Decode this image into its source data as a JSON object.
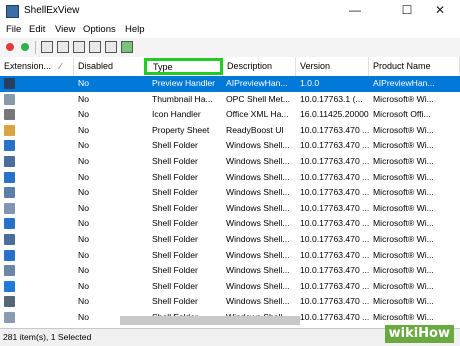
{
  "window": {
    "title": "ShellExView",
    "minimize": "—",
    "maximize": "☐",
    "close": "✕"
  },
  "menu": [
    "File",
    "Edit",
    "View",
    "Options",
    "Help"
  ],
  "colors": {
    "selection": "#0078d7",
    "highlight_box": "#22cc22"
  },
  "columns": [
    {
      "key": "ext",
      "label": "Extension...",
      "sort": "∕"
    },
    {
      "key": "disabled",
      "label": "Disabled"
    },
    {
      "key": "type",
      "label": "Type"
    },
    {
      "key": "desc",
      "label": "Description"
    },
    {
      "key": "ver",
      "label": "Version"
    },
    {
      "key": "prod",
      "label": "Product Name"
    }
  ],
  "rows": [
    {
      "icon_color": "#2a3f5f",
      "disabled": "No",
      "type": "Preview Handler",
      "desc": "AIPreviewHan...",
      "ver": "1.0.0",
      "prod": "AIPreviewHan...",
      "selected": true
    },
    {
      "icon_color": "#8899aa",
      "disabled": "No",
      "type": "Thumbnail Ha...",
      "desc": "OPC Shell Met...",
      "ver": "10.0.17763.1 (...",
      "prod": "Microsoft® Wi...",
      "selected": false
    },
    {
      "icon_color": "#777777",
      "disabled": "No",
      "type": "Icon Handler",
      "desc": "Office XML Ha...",
      "ver": "16.0.11425.20000",
      "prod": "Microsoft Offi...",
      "selected": false
    },
    {
      "icon_color": "#d9a441",
      "disabled": "No",
      "type": "Property Sheet",
      "desc": "ReadyBoost UI",
      "ver": "10.0.17763.470 ...",
      "prod": "Microsoft® Wi...",
      "selected": false
    },
    {
      "icon_color": "#2a72c9",
      "disabled": "No",
      "type": "Shell Folder",
      "desc": "Windows Shell...",
      "ver": "10.0.17763.470 ...",
      "prod": "Microsoft® Wi...",
      "selected": false
    },
    {
      "icon_color": "#4a6d9e",
      "disabled": "No",
      "type": "Shell Folder",
      "desc": "Windows Shell...",
      "ver": "10.0.17763.470 ...",
      "prod": "Microsoft® Wi...",
      "selected": false
    },
    {
      "icon_color": "#2a72c9",
      "disabled": "No",
      "type": "Shell Folder",
      "desc": "Windows Shell...",
      "ver": "10.0.17763.470 ...",
      "prod": "Microsoft® Wi...",
      "selected": false
    },
    {
      "icon_color": "#5b7fa8",
      "disabled": "No",
      "type": "Shell Folder",
      "desc": "Windows Shell...",
      "ver": "10.0.17763.470 ...",
      "prod": "Microsoft® Wi...",
      "selected": false
    },
    {
      "icon_color": "#7f95b3",
      "disabled": "No",
      "type": "Shell Folder",
      "desc": "Windows Shell...",
      "ver": "10.0.17763.470 ...",
      "prod": "Microsoft® Wi...",
      "selected": false
    },
    {
      "icon_color": "#2a72c9",
      "disabled": "No",
      "type": "Shell Folder",
      "desc": "Windows Shell...",
      "ver": "10.0.17763.470 ...",
      "prod": "Microsoft® Wi...",
      "selected": false
    },
    {
      "icon_color": "#4a6d9e",
      "disabled": "No",
      "type": "Shell Folder",
      "desc": "Windows Shell...",
      "ver": "10.0.17763.470 ...",
      "prod": "Microsoft® Wi...",
      "selected": false
    },
    {
      "icon_color": "#2a72c9",
      "disabled": "No",
      "type": "Shell Folder",
      "desc": "Windows Shell...",
      "ver": "10.0.17763.470 ...",
      "prod": "Microsoft® Wi...",
      "selected": false
    },
    {
      "icon_color": "#6a86a8",
      "disabled": "No",
      "type": "Shell Folder",
      "desc": "Windows Shell...",
      "ver": "10.0.17763.470 ...",
      "prod": "Microsoft® Wi...",
      "selected": false
    },
    {
      "icon_color": "#1e7bd8",
      "disabled": "No",
      "type": "Shell Folder",
      "desc": "Windows Shell...",
      "ver": "10.0.17763.470 ...",
      "prod": "Microsoft® Wi...",
      "selected": false
    },
    {
      "icon_color": "#556677",
      "disabled": "No",
      "type": "Shell Folder",
      "desc": "Windows Shell...",
      "ver": "10.0.17763.470 ...",
      "prod": "Microsoft® Wi...",
      "selected": false
    },
    {
      "icon_color": "#8a9bb0",
      "disabled": "No",
      "type": "Shell Folder",
      "desc": "Windows Shell...",
      "ver": "10.0.17763.470 ...",
      "prod": "Microsoft® Wi...",
      "selected": false
    }
  ],
  "status": {
    "text": "281 item(s), 1 Selected"
  },
  "watermark": "wikiHow"
}
